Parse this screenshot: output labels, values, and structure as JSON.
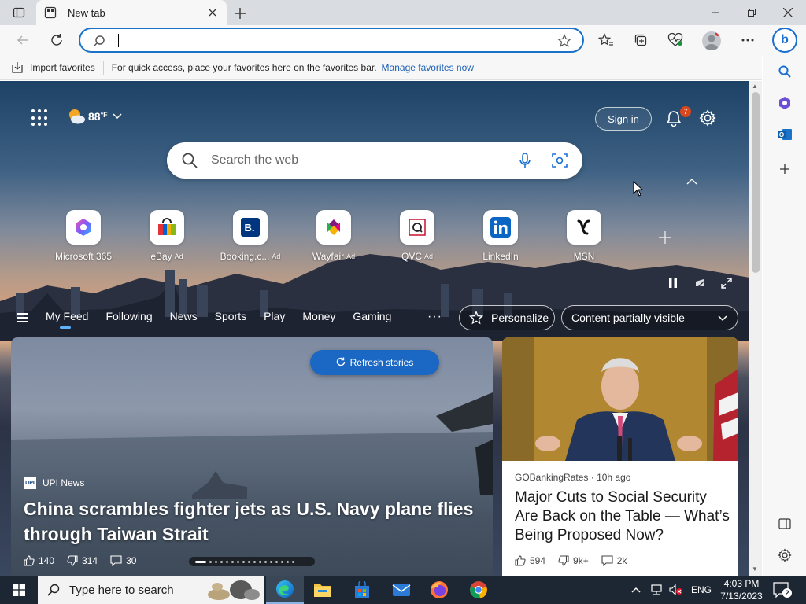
{
  "browser": {
    "tab": {
      "title": "New tab"
    },
    "address": {
      "value": "",
      "placeholder": ""
    },
    "favorites_bar": {
      "import_label": "Import favorites",
      "hint": "For quick access, place your favorites here on the favorites bar.",
      "manage_link": "Manage favorites now"
    },
    "sidebar": {
      "bing_label": "b"
    }
  },
  "newtab": {
    "weather": {
      "temp": "88",
      "unit": "°F"
    },
    "signin_label": "Sign in",
    "notifications_count": "7",
    "search": {
      "placeholder": "Search the web"
    },
    "quick_links": [
      {
        "label": "Microsoft 365",
        "ad": "",
        "icon": "microsoft-365-icon"
      },
      {
        "label": "eBay",
        "ad": "Ad",
        "icon": "ebay-icon"
      },
      {
        "label": "Booking.c...",
        "ad": "Ad",
        "icon": "booking-icon"
      },
      {
        "label": "Wayfair",
        "ad": "Ad",
        "icon": "wayfair-icon"
      },
      {
        "label": "QVC",
        "ad": "Ad",
        "icon": "qvc-icon"
      },
      {
        "label": "LinkedIn",
        "ad": "",
        "icon": "linkedin-icon"
      },
      {
        "label": "MSN",
        "ad": "",
        "icon": "msn-icon"
      }
    ],
    "feed_tabs": [
      "My Feed",
      "Following",
      "News",
      "Sports",
      "Play",
      "Money",
      "Gaming"
    ],
    "more_label": "···",
    "personalize_label": "Personalize",
    "visibility_label": "Content partially visible",
    "refresh_label": "Refresh stories",
    "hero_story": {
      "source_logo": "UPI",
      "source": "UPI News",
      "headline": "China scrambles fighter jets as U.S. Navy plane flies through Taiwan Strait",
      "likes": "140",
      "dislikes": "314",
      "comments": "30"
    },
    "side_story": {
      "source": "GOBankingRates",
      "age": "10h ago",
      "title": "Major Cuts to Social Security Are Back on the Table — What’s Being Proposed Now?",
      "likes": "594",
      "dislikes": "9k+",
      "comments": "2k"
    }
  },
  "taskbar": {
    "search_placeholder": "Type here to search",
    "language": "ENG",
    "time": "4:03 PM",
    "date": "7/13/2023",
    "notification_count": "2"
  }
}
